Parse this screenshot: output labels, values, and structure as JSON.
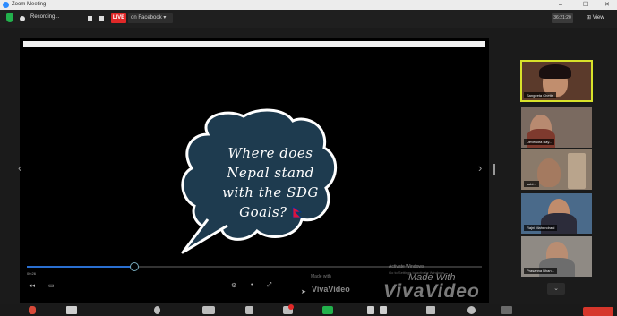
{
  "window": {
    "title": "Zoom Meeting"
  },
  "topbar": {
    "recording_label": "Recording...",
    "live_label": "LIVE",
    "facebook_label": "on Facebook ▾",
    "gallery_label": "36:21:20",
    "view_label": "View"
  },
  "share": {
    "line1": "Where does",
    "line2": "Nepal stand",
    "line3": "with the SDG",
    "line4": "Goals?",
    "timecode": "00:26",
    "made_with_small": "Made with",
    "vivavideo_small": "VivaVideo",
    "activate_windows": "Activate Windows",
    "activate_windows_sub": "Go to Settings to activate Windows.",
    "made_with_big": "Made With",
    "vivavideo_big": "VivaVideo"
  },
  "participants": [
    {
      "name": "Sangeeta Chettri",
      "active": true,
      "bg": "#5b3a2b"
    },
    {
      "name": "Devendra Bay...",
      "active": false,
      "bg": "#7a6a60"
    },
    {
      "name": "sabi...",
      "active": false,
      "bg": "#8a7a6a"
    },
    {
      "name": "Rajni Mahendrani",
      "active": false,
      "bg": "#4a6a8a"
    },
    {
      "name": "Prasanna Bhan...",
      "active": false,
      "bg": "#8f8a84"
    }
  ],
  "colors": {
    "accent_live": "#e02828",
    "active_speaker": "#d8e22a",
    "security": "#22b14c",
    "bubble": "#1e3b4f"
  }
}
